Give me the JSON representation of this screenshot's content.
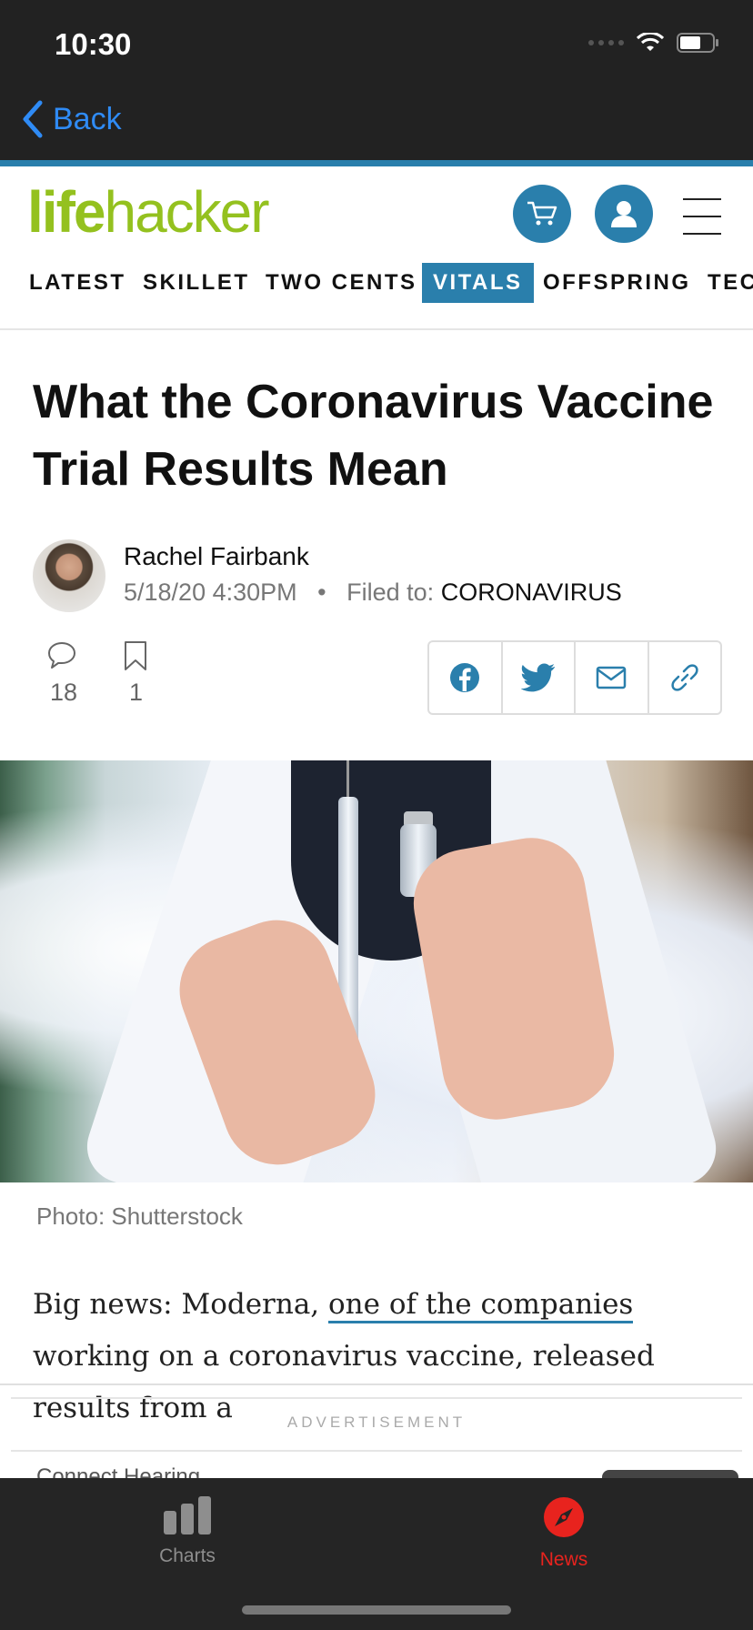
{
  "status_bar": {
    "time": "10:30"
  },
  "nav": {
    "back_label": "Back"
  },
  "site": {
    "logo_part1": "life",
    "logo_part2": "hacker",
    "brand_color": "#94c11f",
    "accent_color": "#2a7fac"
  },
  "sections": [
    {
      "label": "LATEST",
      "active": false
    },
    {
      "label": "SKILLET",
      "active": false
    },
    {
      "label": "TWO CENTS",
      "active": false
    },
    {
      "label": "VITALS",
      "active": true
    },
    {
      "label": "OFFSPRING",
      "active": false
    },
    {
      "label": "TEC",
      "active": false
    }
  ],
  "article": {
    "title": "What the Coronavirus Vaccine Trial Results Mean",
    "author": "Rachel Fairbank",
    "date": "5/18/20 4:30PM",
    "filed_label": "Filed to:",
    "filed_value": "CORONAVIRUS",
    "comment_count": "18",
    "bookmark_count": "1",
    "photo_caption": "Photo: Shutterstock",
    "body_before_link": "Big news: Moderna, ",
    "body_link": "one of the companies",
    "body_after_link": " working on a coronavirus vaccine, released results from a"
  },
  "share_icons": [
    "facebook-icon",
    "twitter-icon",
    "mail-icon",
    "link-icon"
  ],
  "ad": {
    "label": "ADVERTISEMENT",
    "sponsor": "Connect Hearing"
  },
  "tabbar": {
    "tabs": [
      {
        "label": "Charts",
        "icon": "bar-chart-icon",
        "active": false
      },
      {
        "label": "News",
        "icon": "compass-icon",
        "active": true
      }
    ],
    "active_color": "#e8231e"
  }
}
